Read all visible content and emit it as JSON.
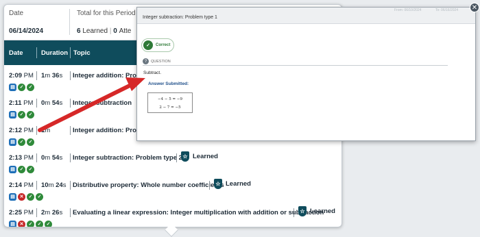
{
  "summary": {
    "date_header": "Date",
    "total_header": "Total for this Period",
    "date_value": "06/14/2024",
    "learned_count": "6",
    "learned_label": "Learned",
    "attempted_count": "0",
    "attempted_label": "Atte"
  },
  "table": {
    "columns": [
      "Date",
      "Duration",
      "Topic"
    ],
    "learned_label": "Learned",
    "rows": [
      {
        "time": "2:09",
        "ampm": "PM",
        "dur_m": "1",
        "dur_s": "36",
        "topic": "Integer addition: Proble",
        "learned": false,
        "icons": [
          "doc",
          "ok",
          "ok"
        ]
      },
      {
        "time": "2:11",
        "ampm": "PM",
        "dur_m": "0",
        "dur_s": "54",
        "topic": "Integer subtraction",
        "learned": false,
        "icons": [
          "doc",
          "ok",
          "ok"
        ]
      },
      {
        "time": "2:12",
        "ampm": "PM",
        "dur_m": "1",
        "dur_s": "",
        "topic": "Integer addition: Proble",
        "learned": false,
        "icons": [
          "doc",
          "ok",
          "ok"
        ]
      },
      {
        "time": "2:13",
        "ampm": "PM",
        "dur_m": "0",
        "dur_s": "54",
        "topic": "Integer subtraction: Problem type 2",
        "learned": true,
        "icons": [
          "doc",
          "ok",
          "ok"
        ]
      },
      {
        "time": "2:14",
        "ampm": "PM",
        "dur_m": "10",
        "dur_s": "24",
        "topic": "Distributive property: Whole number coefficients",
        "learned": true,
        "icons": [
          "doc",
          "bad",
          "ok",
          "ok"
        ]
      },
      {
        "time": "2:25",
        "ampm": "PM",
        "dur_m": "2",
        "dur_s": "26",
        "topic": "Evaluating a linear expression: Integer multiplication with addition or subtraction",
        "learned": true,
        "icons": [
          "doc",
          "bad",
          "ok",
          "ok",
          "ok"
        ]
      }
    ]
  },
  "modal": {
    "title": "Integer subtraction: Problem type 1",
    "correct_label": "Correct",
    "question_label": "QUESTION",
    "question_text": "Subtract.",
    "answer_label": "Answer Submitted:",
    "answer_lines": [
      "−4 − 5  =  −9",
      "2 − 7  =  −5"
    ],
    "close_glyph": "✕",
    "ghost_from": "From: 06/10/2024",
    "ghost_to": "To: 06/16/2024"
  },
  "icons": {
    "doc": "▤",
    "ok": "✓",
    "bad": "✕",
    "learned_badge": "☆",
    "question": "?"
  },
  "colors": {
    "header_bg": "#0f4c5c",
    "correct": "#2f8a3a",
    "incorrect": "#c62828",
    "arrow": "#d62828"
  }
}
